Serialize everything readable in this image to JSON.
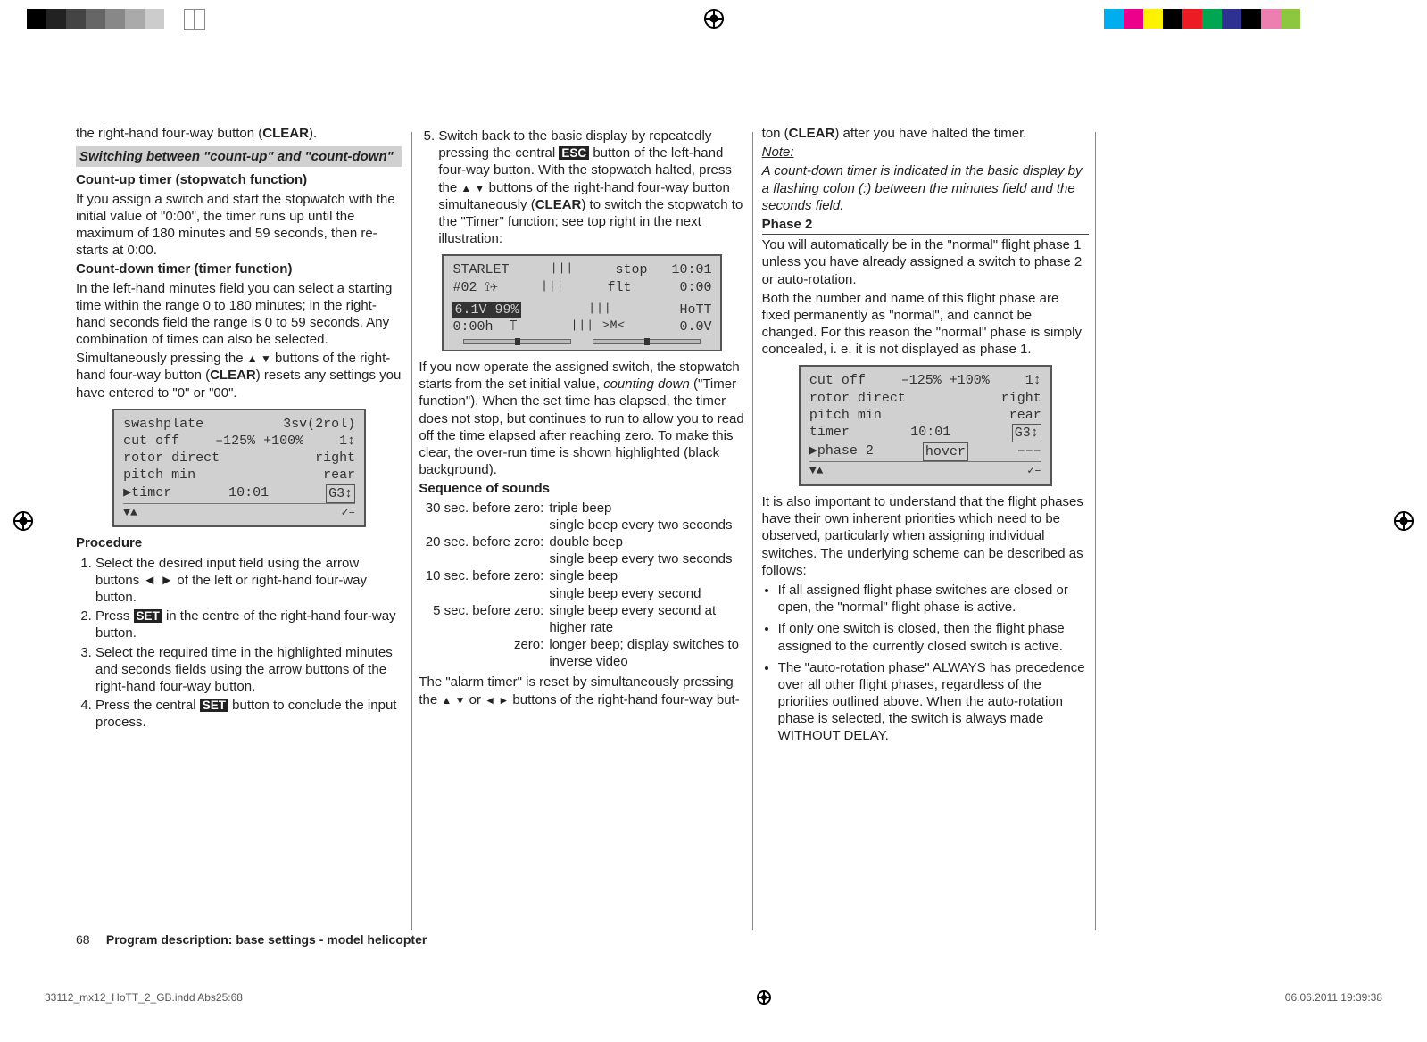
{
  "par": {
    "a": "the right-hand four-way button (",
    "clear": "CLEAR",
    "b": ").",
    "switching": "Switching between \"count-up\" and \"count-down\"",
    "countup_h": "Count-up timer (stopwatch function)",
    "countup_p": "If you assign a switch and start the stopwatch with the initial value of \"0:00\", the timer runs up until the maximum of 180 minutes and 59 seconds, then re-starts at 0:00.",
    "countdown_h": "Count-down timer (timer function)",
    "countdown_p1": "In the left-hand minutes field you can select a starting time within the range 0 to 180 minutes; in the right-hand seconds field the range is 0 to 59 seconds. Any combination of times can also be selected.",
    "countdown_p2a": "Simultaneously pressing the ",
    "countdown_p2b": " buttons of the right-hand four-way button (",
    "countdown_p2c": ") resets any settings you have entered to \"0\" or \"00\".",
    "procedure_h": "Procedure",
    "proc": [
      "Select the desired input field using the arrow buttons ◄ ► of the left or right-hand four-way button.",
      "Press |SET| in the centre of the right-hand four-way button.",
      "Select the required time in the highlighted minutes and seconds fields using the arrow buttons of the right-hand four-way button.",
      "Press the central |SET| button to conclude the input process."
    ],
    "step5a": "Switch back to the basic display by repeatedly pressing the central ",
    "esc": "ESC",
    "step5b": " button of the left-hand four-way button. With the stopwatch halted, press the ",
    "step5c": " buttons of the right-hand four-way button simultaneously (",
    "step5d": ") to switch the stopwatch to the \"Timer\" function; see top right in the next illustration:",
    "after_display": "If you now operate the assigned switch, the stopwatch starts from the set initial value, ",
    "after_display_i": "counting down",
    "after_display2": " (\"Timer function\"). When the set time has elapsed, the timer does not stop, but continues to run to allow you to read off the time elapsed after reaching zero. To make this clear, the over-run time is shown highlighted (black background).",
    "sounds_h": "Sequence of sounds",
    "sounds": [
      [
        "30 sec. before zero:",
        "triple beep"
      ],
      [
        "",
        "single beep every two seconds"
      ],
      [
        "20 sec. before zero:",
        "double beep"
      ],
      [
        "",
        "single beep every two seconds"
      ],
      [
        "10 sec. before zero:",
        "single beep"
      ],
      [
        "",
        "single beep every second"
      ],
      [
        "5 sec. before zero:",
        "single beep every second at higher rate"
      ],
      [
        "zero:",
        "longer beep; display switches to inverse video"
      ]
    ],
    "alarm_p1": "The \"alarm timer\" is reset by simultaneously pressing the ",
    "alarm_p2": " or ",
    "alarm_p3": " buttons of the right-hand four-way but-",
    "col3_top": "ton (",
    "col3_top2": ") after you have halted the timer.",
    "note_lbl": "Note:",
    "note_p": "A count-down timer is indicated in the basic display by a flashing colon (:) between the minutes field and the seconds field.",
    "phase2_h": "Phase 2",
    "phase2_p1": "You will automatically be in the \"normal\" flight phase 1 unless you have already assigned a switch to phase 2 or auto-rotation.",
    "phase2_p2": "Both the number and name of this flight phase are fixed permanently as \"normal\", and cannot be changed. For this reason the \"normal\" phase is simply concealed, i. e. it is not displayed as phase 1.",
    "phase2_after": "It is also important to understand that the flight phases have their own inherent priorities which need to be observed, particularly when assigning individual switches. The underlying scheme can be described as follows:",
    "bullets": [
      "If all assigned flight phase switches are closed or open, the \"normal\" flight phase is active.",
      "If only one switch is closed, then the flight phase assigned to the currently closed switch is active.",
      "The \"auto-rotation phase\" ALWAYS has precedence over all other flight phases, regardless of the priorities outlined above. When the auto-rotation phase is selected, the switch is always made WITHOUT DELAY."
    ]
  },
  "lcd1": {
    "r1_l": "swashplate",
    "r1_r": "3sv(2rol)",
    "r2_l": "cut off",
    "r2_m": "–125% +100%",
    "r2_r": "1↕",
    "r3_l": "rotor direct",
    "r3_r": "right",
    "r4_l": "pitch min",
    "r4_r": "rear",
    "r5_l": "▶timer",
    "r5_m": "10:01",
    "r5_r": "G3↕",
    "nav_l": "▼▲",
    "nav_r": "✓‒"
  },
  "display": {
    "name": "STARLET",
    "model": "#02",
    "stop": "stop",
    "stop_t": "10:01",
    "flt": "flt",
    "flt_t": "0:00",
    "volt": "6.1V",
    "pct": "99%",
    "hott": "HoTT",
    "hours": "0:00h",
    "rv": "0.0V"
  },
  "lcd2": {
    "r1_l": "cut off",
    "r1_m": "–125% +100%",
    "r1_r": "1↕",
    "r2_l": "rotor direct",
    "r2_r": "right",
    "r3_l": "pitch min",
    "r3_r": "rear",
    "r4_l": "timer",
    "r4_m": "10:01",
    "r4_r": "G3↕",
    "r5_l": "▶phase 2",
    "r5_m": "hover",
    "r5_r": "–––",
    "nav_l": "▼▲",
    "nav_r": "✓‒"
  },
  "footer": {
    "num": "68",
    "title": "Program description: base settings - model helicopter",
    "doc": "33112_mx12_HoTT_2_GB.indd   Abs25:68",
    "date": "06.06.2011   19:39:38"
  },
  "reg_colors_left": [
    "#000",
    "#222",
    "#444",
    "#666",
    "#888",
    "#aaa",
    "#ccc",
    "#fff"
  ],
  "reg_colors_right": [
    "#00adee",
    "#ec008c",
    "#fff200",
    "#000",
    "#ed1c24",
    "#00a651",
    "#2e3192",
    "#000",
    "#ec7faf",
    "#8dc63f",
    "#fff"
  ]
}
